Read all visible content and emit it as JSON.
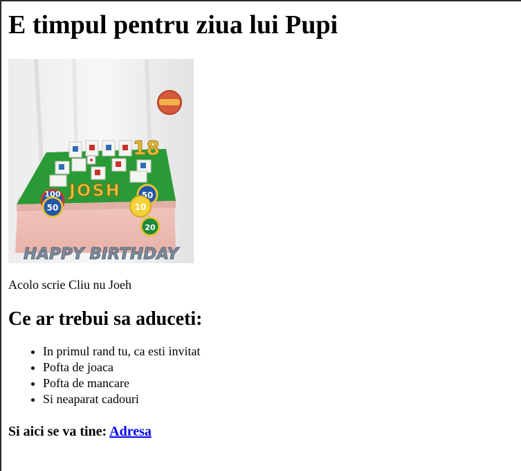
{
  "page": {
    "title": "E timpul pentru ziua lui Pupi",
    "image": {
      "cake_name": "JOSH",
      "cake_text": "HAPPY BIRTHDAY",
      "candle_number": "18",
      "chips": [
        "100",
        "50",
        "50",
        "10",
        "20"
      ]
    },
    "caption": "Acolo scrie Cliu nu Joeh",
    "bring_heading": "Ce ar trebui sa aduceti:",
    "bring_items": [
      "In primul rand tu, ca esti invitat",
      "Pofta de joaca",
      "Pofta de mancare",
      "Si neaparat cadouri"
    ],
    "address_label": "Si aici se va tine:",
    "address_link": "Adresa"
  }
}
